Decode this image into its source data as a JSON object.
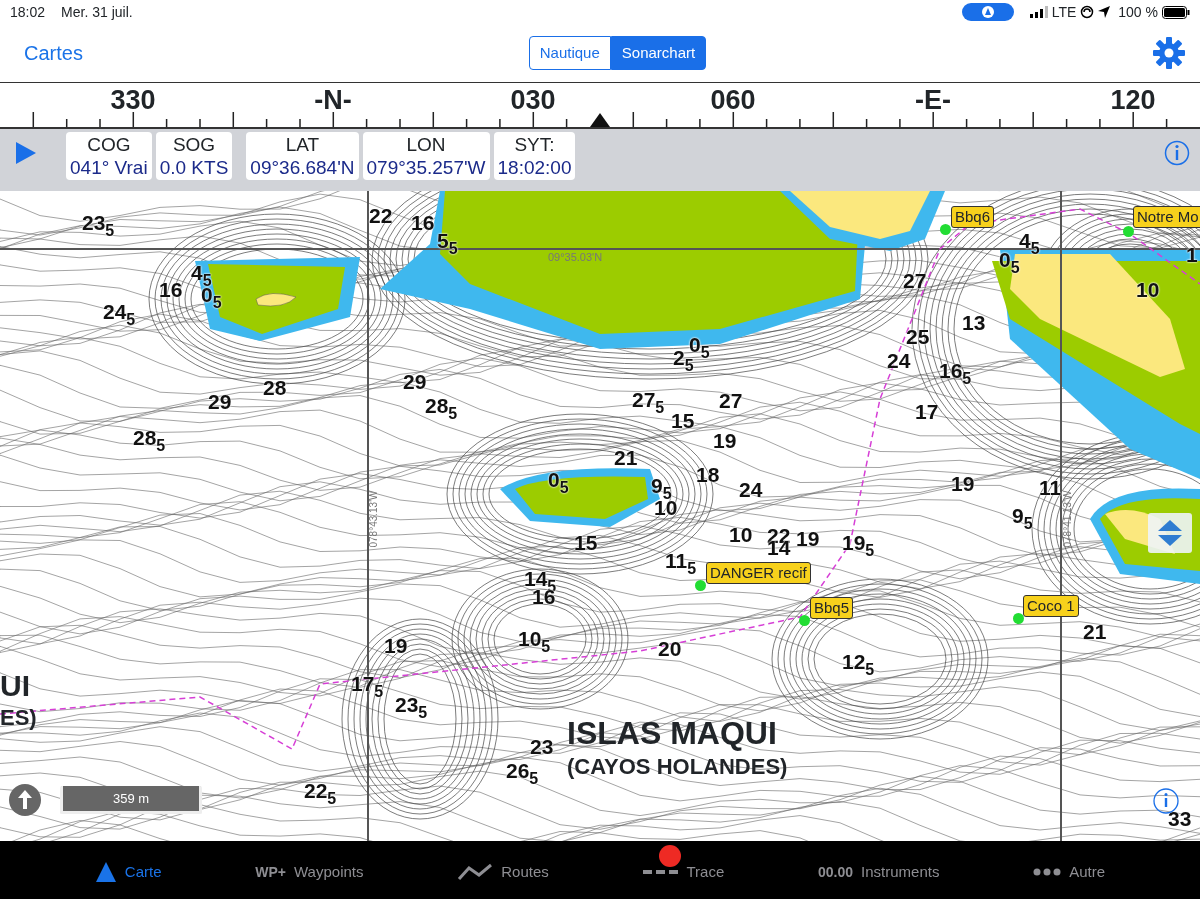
{
  "status_bar": {
    "time": "18:02",
    "date": "Mer. 31 juil.",
    "network": "LTE",
    "battery": "100 %"
  },
  "nav": {
    "back": "Cartes",
    "segments": [
      {
        "label": "Nautique",
        "selected": false
      },
      {
        "label": "Sonarchart",
        "selected": true
      }
    ]
  },
  "compass": {
    "labels": [
      "330",
      "-N-",
      "030",
      "060",
      "-E-",
      "120"
    ]
  },
  "instruments": [
    {
      "label": "COG",
      "value": "041° Vrai"
    },
    {
      "label": "SOG",
      "value": "0.0 KTS"
    },
    {
      "label": "LAT",
      "value": "09°36.684'N"
    },
    {
      "label": "LON",
      "value": "079°35.257'W"
    },
    {
      "label": "SYT:",
      "value": "18:02:00"
    }
  ],
  "map": {
    "soundings": [
      "23$_{5}$",
      "22",
      "16",
      "5$_{5}$",
      "4$_{5}$",
      "16",
      "0$_{5}$",
      "24$_{5}$",
      "28",
      "29",
      "28$_{5}$",
      "29",
      "28$_{5}$",
      "0$_{5}$",
      "2$_{5}$",
      "27",
      "25",
      "24",
      "13",
      "16$_{5}$",
      "17",
      "4$_{5}$",
      "0$_{5}$",
      "10",
      "1",
      "27$_{5}$",
      "27",
      "15",
      "19",
      "21",
      "0$_{5}$",
      "9$_{5}$",
      "18",
      "24",
      "10",
      "19",
      "11",
      "9$_{5}$",
      "15",
      "10",
      "22",
      "14",
      "19",
      "19$_{5}$",
      "11$_{5}$",
      "14$_{5}$",
      "16",
      "19",
      "10$_{5}$",
      "17$_{5}$",
      "23$_{5}$",
      "20",
      "12$_{5}$",
      "21",
      "22$_{5}$",
      "23",
      "26$_{5}$",
      "33"
    ],
    "waypoints": [
      {
        "name": "Bbq6"
      },
      {
        "name": "Notre Mo"
      },
      {
        "name": "DANGER recif"
      },
      {
        "name": "Bbq5"
      },
      {
        "name": "Coco 1"
      }
    ],
    "place_labels": [
      "UI",
      "ES)",
      "ISLAS MAQUI",
      "(CAYOS HOLANDES)"
    ],
    "grid_labels": [
      "09°35.03'N",
      "078°43.13'W",
      "078°41.13'W"
    ],
    "scale": "359 m"
  },
  "tab_bar": [
    {
      "label": "Carte",
      "kind": "chart",
      "selected": true,
      "recording": false
    },
    {
      "label": "Waypoints",
      "kind": "waypoint",
      "icon_text": "WP+",
      "selected": false,
      "recording": false
    },
    {
      "label": "Routes",
      "kind": "route",
      "selected": false,
      "recording": false
    },
    {
      "label": "Trace",
      "kind": "track",
      "selected": false,
      "recording": true
    },
    {
      "label": "Instruments",
      "kind": "instruments",
      "icon_text": "00.00",
      "selected": false,
      "recording": false
    },
    {
      "label": "Autre",
      "kind": "more",
      "selected": false,
      "recording": false
    }
  ]
}
